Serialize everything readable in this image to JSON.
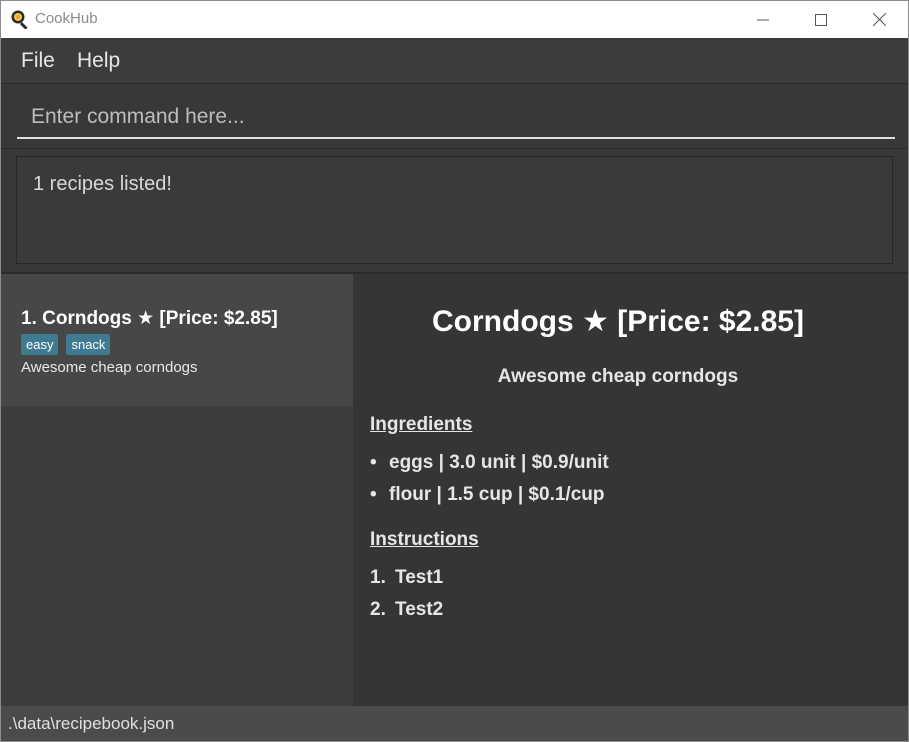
{
  "window": {
    "title": "CookHub"
  },
  "menu": {
    "file_label": "File",
    "help_label": "Help"
  },
  "command": {
    "placeholder": "Enter command here..."
  },
  "result": {
    "message": "1 recipes listed!"
  },
  "recipe_list": {
    "items": [
      {
        "index_title": "1.  Corndogs ★ [Price: $2.85]",
        "tags": [
          "easy",
          "snack"
        ],
        "description": "Awesome cheap corndogs"
      }
    ]
  },
  "detail": {
    "title": "Corndogs ★ [Price: $2.85]",
    "description": "Awesome cheap corndogs",
    "ingredients_heading": "Ingredients",
    "ingredients": [
      "eggs | 3.0 unit | $0.9/unit",
      "flour | 1.5 cup | $0.1/cup"
    ],
    "instructions_heading": "Instructions",
    "instructions": [
      "Test1",
      "Test2"
    ]
  },
  "status": {
    "path": ".\\data\\recipebook.json"
  },
  "colors": {
    "tag_bg": "#3e7b91",
    "background": "#3c3c3c",
    "status_bg": "#4b4b4b"
  },
  "icons": {
    "app": "frying-pan-icon",
    "minimize": "minimize-icon",
    "maximize": "maximize-icon",
    "close": "close-icon"
  }
}
